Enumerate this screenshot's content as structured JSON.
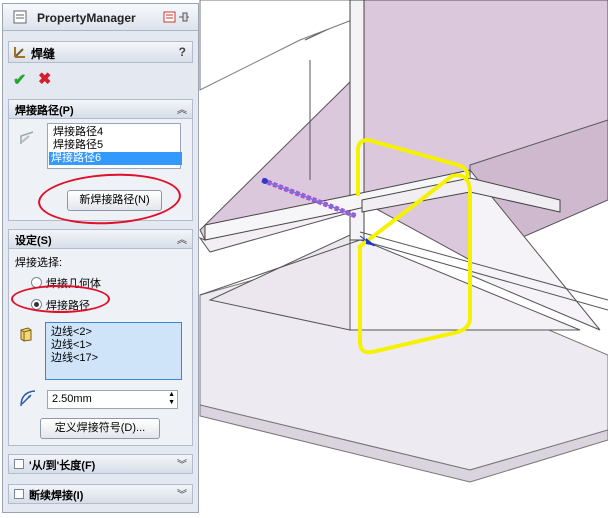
{
  "panel": {
    "title": "PropertyManager",
    "feature_title": "焊缝",
    "help": "?",
    "ok_glyph": "✔",
    "cancel_glyph": "✖"
  },
  "weld_path": {
    "header": "焊接路径(P)",
    "items": [
      "焊接路径4",
      "焊接路径5",
      "焊接路径6"
    ],
    "selected_index": 2,
    "new_button": "新焊接路径(N)"
  },
  "settings": {
    "header": "设定(S)",
    "selection_label": "焊接选择:",
    "radio_geometry": "焊接几何体",
    "radio_path": "焊接路径",
    "radio_selected": "焊接路径",
    "edges": [
      "边线<2>",
      "边线<1>",
      "边线<17>"
    ],
    "size_value": "2.50mm",
    "define_symbol_button": "定义焊接符号(D)..."
  },
  "collapsed_groups": {
    "from_to_length": "'从/到'长度(F)",
    "intermittent_weld": "断续焊接(I)"
  },
  "colors": {
    "accent_red": "#e0102a",
    "highlight_yellow": "#f5f200",
    "face_lilac": "#dcc8dc",
    "selection_blue": "#3399ff"
  }
}
